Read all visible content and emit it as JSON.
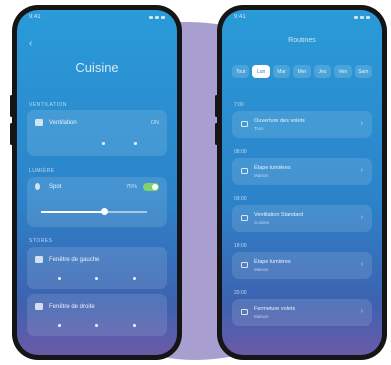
{
  "left_phone": {
    "status_time": "9:41",
    "title": "Cuisine",
    "sections": {
      "ventilation": "VENTILATION",
      "lumiere": "LUMIÈRE",
      "stores": "STORES"
    },
    "ventilation_row": {
      "name": "Ventilation",
      "value": "ON"
    },
    "spot_row": {
      "name": "Spot",
      "value": "75%"
    },
    "store1": {
      "name": "Fenêtre de gauche",
      "value": ""
    },
    "store2": {
      "name": "Fenêtre de droite",
      "value": ""
    },
    "brightness_fraction": 0.6
  },
  "right_phone": {
    "status_time": "9:41",
    "title": "Routines",
    "tabs": [
      "Tout",
      "Lun",
      "Mar",
      "Mer",
      "Jeu",
      "Ven",
      "Sam"
    ],
    "active_tab": 1,
    "groups": [
      {
        "time": "7:00",
        "right": "",
        "item": "Ouverture des volets",
        "sub": "Tous"
      },
      {
        "time": "08:00",
        "right": "",
        "item": "Étape lumières",
        "sub": "Maison"
      },
      {
        "time": "09:00",
        "right": "",
        "item": "Ventilation Standard",
        "sub": "Cuisine"
      },
      {
        "time": "18:00",
        "right": "",
        "item": "Étape lumières",
        "sub": "Maison"
      },
      {
        "time": "20:00",
        "right": "",
        "item": "Fermeture volets",
        "sub": "Maison"
      }
    ]
  }
}
